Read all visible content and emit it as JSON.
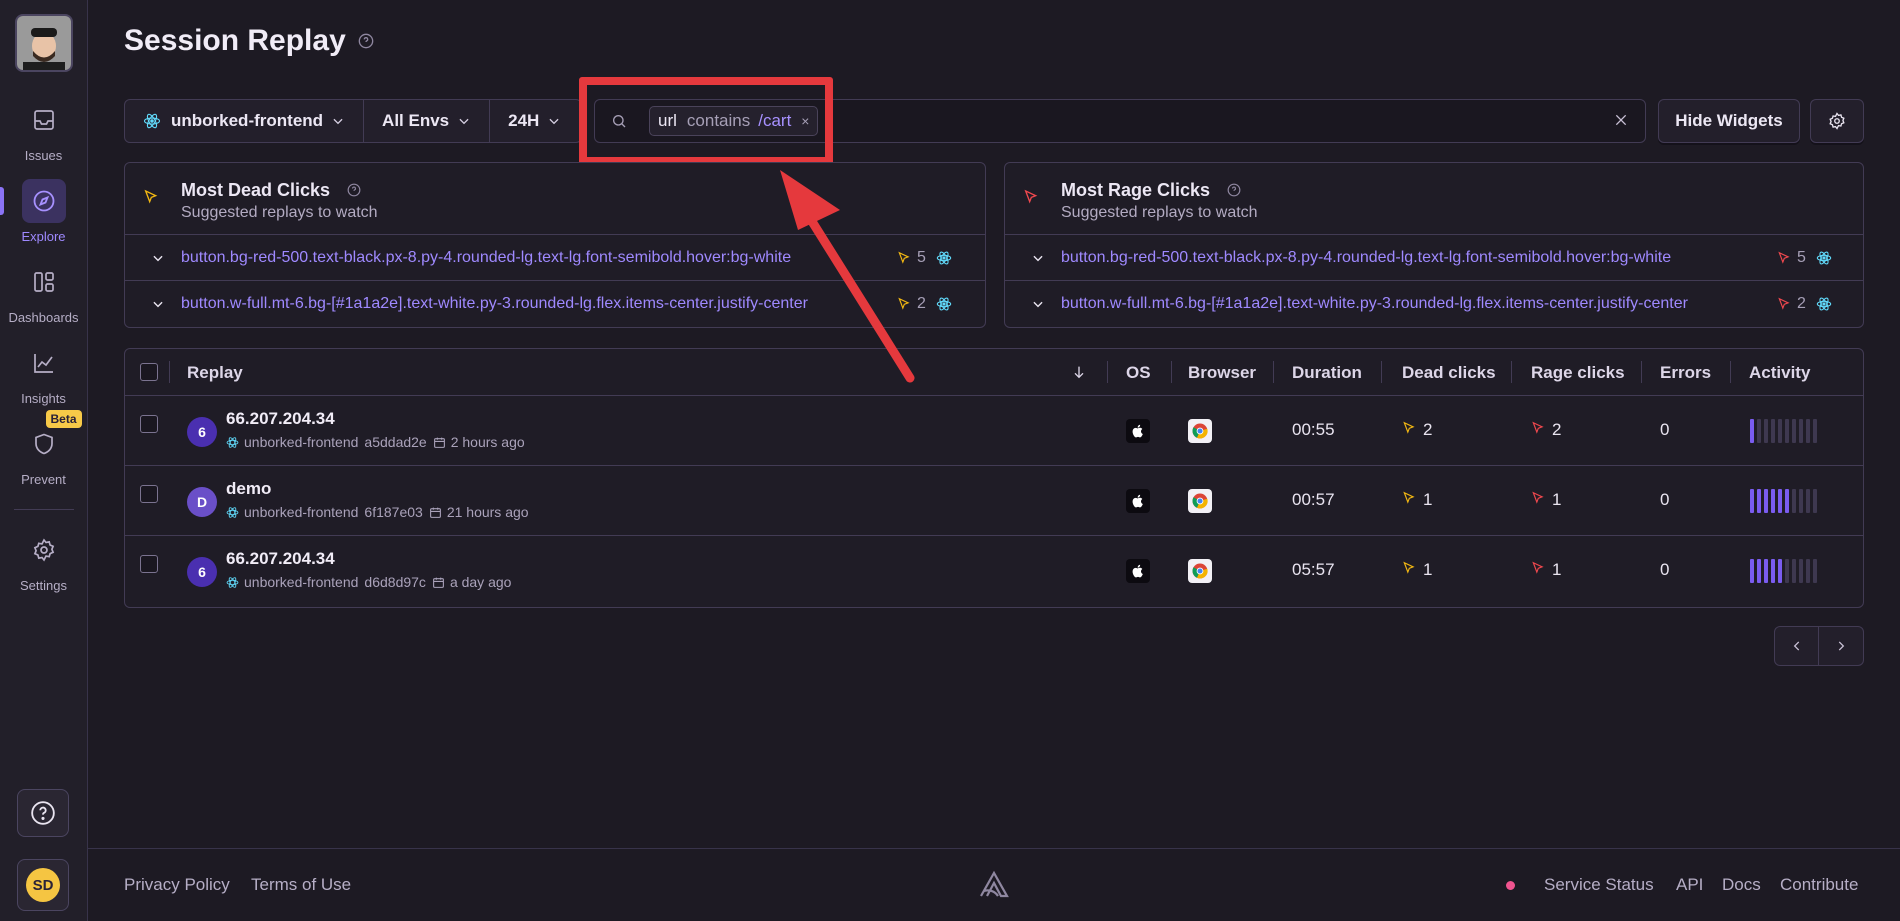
{
  "sidebar": {
    "items": [
      {
        "label": "Issues",
        "icon": "issues-icon"
      },
      {
        "label": "Explore",
        "icon": "compass-icon",
        "active": true
      },
      {
        "label": "Dashboards",
        "icon": "dashboards-icon"
      },
      {
        "label": "Insights",
        "icon": "insights-icon"
      },
      {
        "label": "Prevent",
        "icon": "shield-icon",
        "badge": "Beta"
      },
      {
        "label": "Settings",
        "icon": "gear-icon"
      }
    ],
    "user_initials": "SD"
  },
  "page": {
    "title": "Session Replay"
  },
  "filters": {
    "project": "unborked-frontend",
    "env": "All Envs",
    "period": "24H"
  },
  "search": {
    "token_key": "url",
    "token_op": "contains",
    "token_value": "/cart",
    "token_remove": "×"
  },
  "toolbar": {
    "hide_widgets_label": "Hide Widgets"
  },
  "widgets": {
    "dead": {
      "title": "Most Dead Clicks",
      "subtitle": "Suggested replays to watch",
      "rows": [
        {
          "selector": "button.bg-red-500.text-black.px-8.py-4.rounded-lg.text-lg.font-semibold.hover:bg-white",
          "count": "5"
        },
        {
          "selector": "button.w-full.mt-6.bg-[#1a1a2e].text-white.py-3.rounded-lg.flex.items-center.justify-center",
          "count": "2"
        }
      ]
    },
    "rage": {
      "title": "Most Rage Clicks",
      "subtitle": "Suggested replays to watch",
      "rows": [
        {
          "selector": "button.bg-red-500.text-black.px-8.py-4.rounded-lg.text-lg.font-semibold.hover:bg-white",
          "count": "5"
        },
        {
          "selector": "button.w-full.mt-6.bg-[#1a1a2e].text-white.py-3.rounded-lg.flex.items-center.justify-center",
          "count": "2"
        }
      ]
    }
  },
  "table": {
    "headers": {
      "replay": "Replay",
      "os": "OS",
      "browser": "Browser",
      "duration": "Duration",
      "dead_clicks": "Dead clicks",
      "rage_clicks": "Rage clicks",
      "errors": "Errors",
      "activity": "Activity"
    },
    "rows": [
      {
        "initial": "6",
        "avatar_color": "#4a2fb0",
        "name": "66.207.204.34",
        "project": "unborked-frontend",
        "hash": "a5ddad2e",
        "time": "2 hours ago",
        "duration": "00:55",
        "dead": "2",
        "rage": "2",
        "errors": "0",
        "activity_level": 1
      },
      {
        "initial": "D",
        "avatar_color": "#6a4fc8",
        "name": "demo",
        "project": "unborked-frontend",
        "hash": "6f187e03",
        "time": "21 hours ago",
        "duration": "00:57",
        "dead": "1",
        "rage": "1",
        "errors": "0",
        "activity_level": 6
      },
      {
        "initial": "6",
        "avatar_color": "#4a2fb0",
        "name": "66.207.204.34",
        "project": "unborked-frontend",
        "hash": "d6d8d97c",
        "time": "a day ago",
        "duration": "05:57",
        "dead": "1",
        "rage": "1",
        "errors": "0",
        "activity_level": 5
      }
    ]
  },
  "pager": {
    "prev": "‹",
    "next": "›"
  },
  "footer": {
    "privacy": "Privacy Policy",
    "terms": "Terms of Use",
    "status": "Service Status",
    "api": "API",
    "docs": "Docs",
    "contribute": "Contribute"
  },
  "colors": {
    "accent": "#8b73f5",
    "highlight": "#e5393d",
    "dead_click": "#f2b712",
    "rage_click": "#f0484e"
  }
}
